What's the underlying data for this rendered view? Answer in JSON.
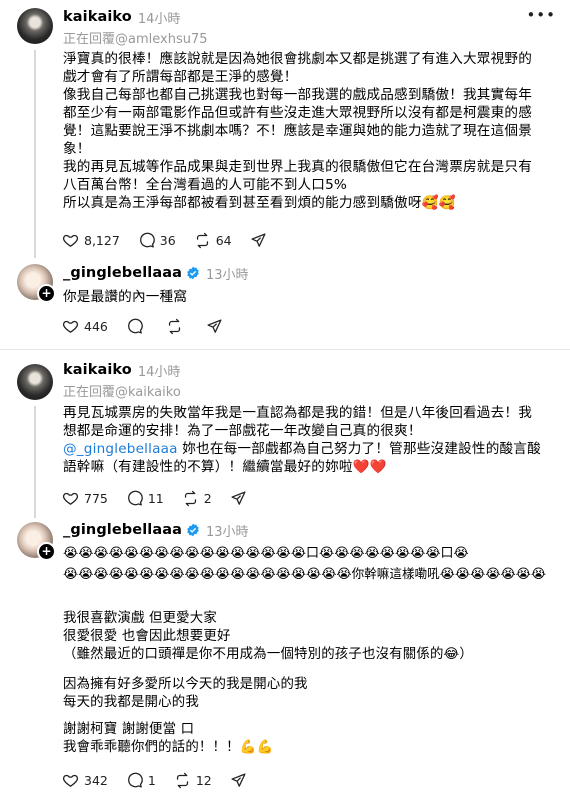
{
  "posts": [
    {
      "username": "kaikaiko",
      "time": "14小時",
      "reply_to": "正在回覆@amlexhsu75",
      "lines": [
        "淨寶真的很棒！應該說就是因為她很會挑劇本又都是挑選了有進入大眾視野的",
        "戲才會有了所謂每部都是王淨的感覺！",
        "像我自己每部也都自己挑選我也對每一部我選的戲成品感到驕傲！我其實每年",
        "都至少有一兩部電影作品但或許有些沒走進大眾視野所以沒有都是柯震東的感",
        "覺！這點要說王淨不挑劇本嗎？不！應該是幸運與她的能力造就了現在這個景",
        "象！",
        "我的再見瓦城等作品成果與走到世界上我真的很驕傲但它在台灣票房就是只有",
        "八百萬台幣！全台灣看過的人可能不到人口5%",
        "所以真是為王淨每部都被看到甚至看到煩的能力感到驕傲呀🥰🥰"
      ],
      "likes": "8,127",
      "comments": "36",
      "reposts": "64"
    },
    {
      "username": "_ginglebellaaa",
      "time": "13小時",
      "lines": [
        "你是最讚的內一種窩"
      ],
      "likes": "446",
      "comments": "",
      "reposts": ""
    },
    {
      "username": "kaikaiko",
      "time": "14小時",
      "reply_to": "正在回覆@kaikaiko",
      "lines": [
        "再見瓦城票房的失敗當年我是一直認為都是我的錯！但是八年後回看過去！我",
        "想都是命運的安排！為了一部戲花一年改變自己真的很爽！"
      ],
      "mention": "@_ginglebellaaa",
      "mention_rest": " 妳也在每一部戲都為自己努力了！管那些沒建設性的酸言酸",
      "lines_after": [
        "語幹嘛（有建設性的不算）！繼續當最好的妳啦❤️❤️"
      ],
      "likes": "775",
      "comments": "11",
      "reposts": "2"
    },
    {
      "username": "_ginglebellaaa",
      "time": "13小時",
      "emoji_row1": "😭😭😭😭😭😭😭😭😭😭😭😭😭😭😭😭口😭😭😭😭😭😭😭😭口😭",
      "emoji_row2_a": "😭😭😭😭😭😭😭😭😭😭😭😭😭😭😭😭😭😭😭",
      "emoji_row2_text": "你幹嘛這樣嘞吼",
      "emoji_row2_b": "😭😭😭😭😭😭😭",
      "para1": [
        "我很喜歡演戲 但更愛大家",
        "很愛很愛 也會因此想要更好",
        "（雖然最近的口頭禪是你不用成為一個特別的孩子也沒有關係的😂）"
      ],
      "para2": [
        "因為擁有好多愛所以今天的我是開心的我",
        "每天的我都是開心的我"
      ],
      "para3": [
        "謝謝柯寶 謝謝便當 口",
        "我會乖乖聽你們的話的！！！💪💪"
      ],
      "likes": "342",
      "comments": "1",
      "reposts": "12"
    }
  ],
  "icons": {
    "more": "more-icon",
    "like": "heart-icon",
    "comment": "comment-icon",
    "repost": "repost-icon",
    "share": "share-icon",
    "verified": "verified-badge-icon"
  },
  "colors": {
    "mention": "#1d7bd8",
    "muted": "#999999",
    "verified": "#1d9bf0"
  }
}
